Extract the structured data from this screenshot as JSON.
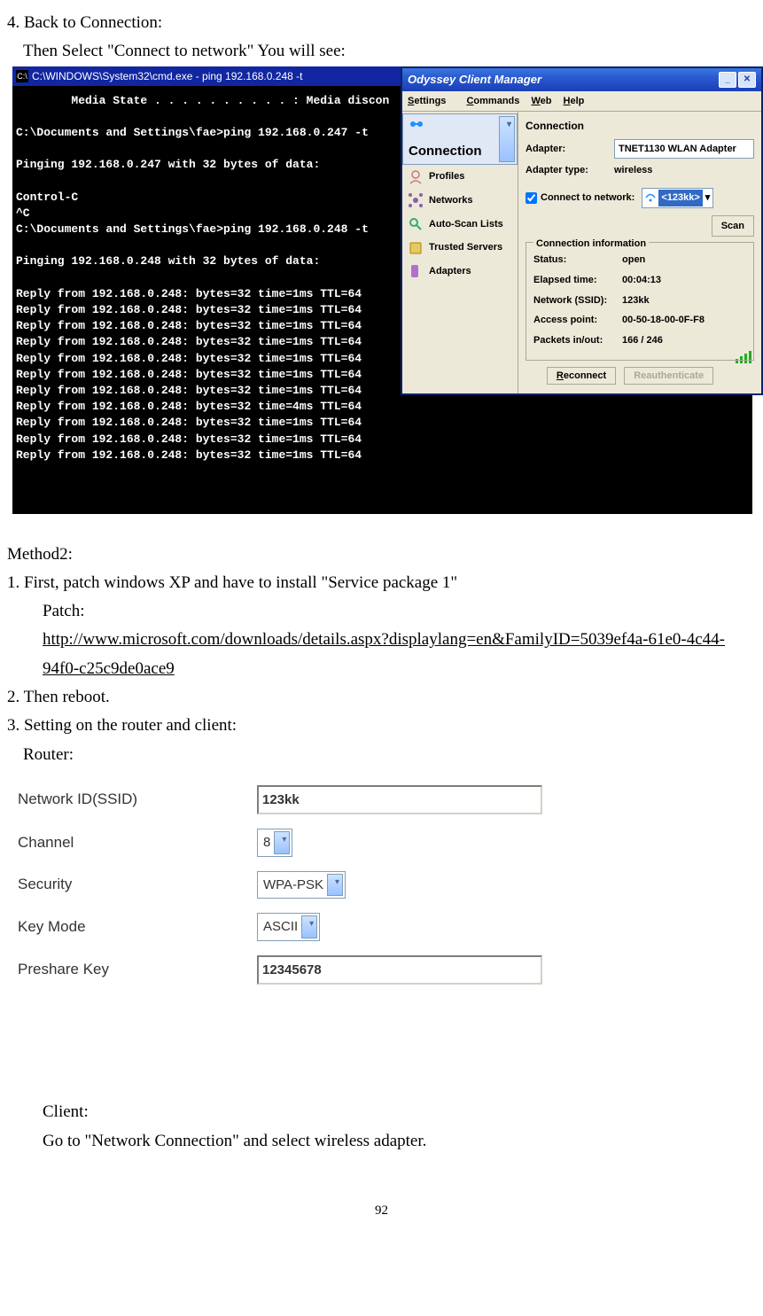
{
  "intro": {
    "line1": "4. Back to Connection:",
    "line2": "Then Select \"Connect to network\" You will see:"
  },
  "cmd": {
    "title": "C:\\WINDOWS\\System32\\cmd.exe - ping 192.168.0.248 -t",
    "body": "        Media State . . . . . . . . . . : Media discon\n\nC:\\Documents and Settings\\fae>ping 192.168.0.247 -t\n\nPinging 192.168.0.247 with 32 bytes of data:\n\nControl-C\n^C\nC:\\Documents and Settings\\fae>ping 192.168.0.248 -t\n\nPinging 192.168.0.248 with 32 bytes of data:\n\nReply from 192.168.0.248: bytes=32 time=1ms TTL=64\nReply from 192.168.0.248: bytes=32 time=1ms TTL=64\nReply from 192.168.0.248: bytes=32 time=1ms TTL=64\nReply from 192.168.0.248: bytes=32 time=1ms TTL=64\nReply from 192.168.0.248: bytes=32 time=1ms TTL=64\nReply from 192.168.0.248: bytes=32 time=1ms TTL=64\nReply from 192.168.0.248: bytes=32 time=1ms TTL=64\nReply from 192.168.0.248: bytes=32 time=4ms TTL=64\nReply from 192.168.0.248: bytes=32 time=1ms TTL=64\nReply from 192.168.0.248: bytes=32 time=1ms TTL=64\nReply from 192.168.0.248: bytes=32 time=1ms TTL=64"
  },
  "odyssey": {
    "title": "Odyssey Client Manager",
    "menu": {
      "settings": "Settings",
      "commands": "Commands",
      "web": "Web",
      "help": "Help"
    },
    "nav": [
      "Connection",
      "Profiles",
      "Networks",
      "Auto-Scan Lists",
      "Trusted Servers",
      "Adapters"
    ],
    "section_title": "Connection",
    "adapter_label": "Adapter:",
    "adapter_value": "TNET1130 WLAN Adapter",
    "adapter_type_label": "Adapter type:",
    "adapter_type_value": "wireless",
    "connect_cb": "Connect to network:",
    "network_value": "<123kk>",
    "scan": "Scan",
    "conninfo_title": "Connection information",
    "info": {
      "status_l": "Status:",
      "status_v": "open",
      "elapsed_l": "Elapsed time:",
      "elapsed_v": "00:04:13",
      "ssid_l": "Network (SSID):",
      "ssid_v": "123kk",
      "ap_l": "Access point:",
      "ap_v": "00-50-18-00-0F-F8",
      "pkt_l": "Packets in/out:",
      "pkt_v": "166 / 246"
    },
    "reconnect": "Reconnect",
    "reauth": "Reauthenticate"
  },
  "method2": {
    "heading": "Method2:",
    "step1": "1. First, patch windows XP and have to install \"Service package 1\"",
    "patch_label": "Patch:",
    "patch_url": "http://www.microsoft.com/downloads/details.aspx?displaylang=en&FamilyID=5039ef4a-61e0-4c44-94f0-c25c9de0ace9",
    "step2": "2. Then reboot.",
    "step3": "3. Setting on the router and client:",
    "router_label": "Router:"
  },
  "router": {
    "ssid_l": "Network ID(SSID)",
    "ssid_v": "123kk",
    "channel_l": "Channel",
    "channel_v": "8",
    "security_l": "Security",
    "security_v": "WPA-PSK",
    "keymode_l": "Key Mode",
    "keymode_v": "ASCII",
    "psk_l": "Preshare Key",
    "psk_v": "12345678"
  },
  "client": {
    "label": "Client:",
    "instruction": "Go to \"Network Connection\" and select wireless adapter."
  },
  "page_number": "92"
}
